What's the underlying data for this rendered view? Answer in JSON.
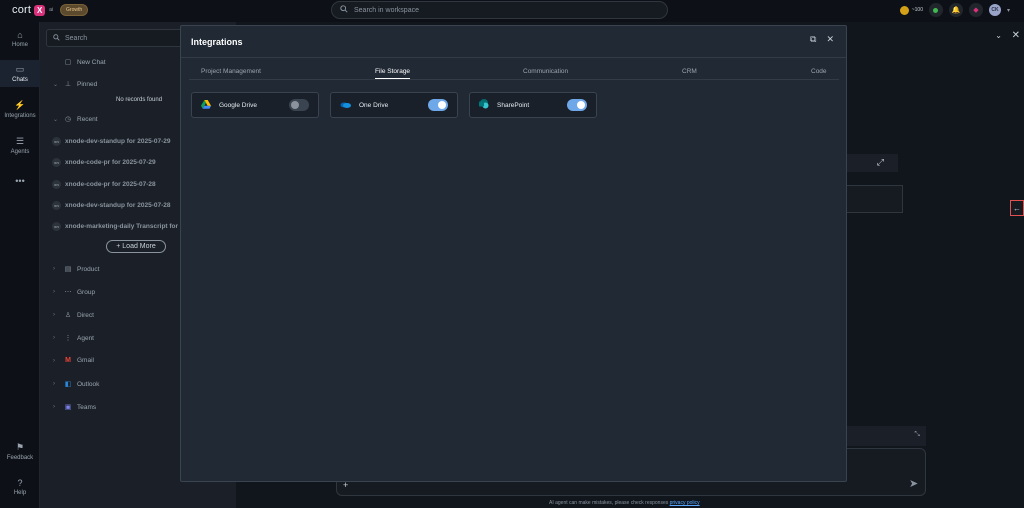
{
  "topbar": {
    "logo_text": "cort",
    "logo_mark": "X",
    "logo_suffix": "ai",
    "badge": "Growth",
    "search_placeholder": "Search in workspace",
    "credits": "~100",
    "avatar_initials": "CK"
  },
  "nav": {
    "items": [
      {
        "label": "Home",
        "icon": "home-icon"
      },
      {
        "label": "Chats",
        "icon": "chat-icon"
      },
      {
        "label": "Integrations",
        "icon": "plug-icon"
      },
      {
        "label": "Agents",
        "icon": "agents-icon"
      },
      {
        "label": "Feedback",
        "icon": "feedback-icon"
      },
      {
        "label": "Help",
        "icon": "help-icon"
      }
    ]
  },
  "sidebar": {
    "search_placeholder": "Search",
    "new_chat": "New Chat",
    "pinned": "Pinned",
    "no_records": "No records found",
    "recent": "Recent",
    "recent_items": [
      "xnode-dev-standup for 2025-07-29",
      "xnode-code-pr for 2025-07-29",
      "xnode-code-pr for 2025-07-28",
      "xnode-dev-standup for 2025-07-28",
      "xnode-marketing-daily Transcript for ..."
    ],
    "load_more": "+ Load More",
    "groups": [
      "Product",
      "Group",
      "Direct",
      "Agent",
      "Gmail",
      "Outlook",
      "Teams"
    ]
  },
  "composer": {
    "disclaimer": "AI agent can make mistakes, please check responses",
    "disclaimer_link": "privacy policy"
  },
  "modal": {
    "title": "Integrations",
    "tabs": [
      "Project Management",
      "File Storage",
      "Communication",
      "CRM",
      "Code"
    ],
    "active_tab": "File Storage",
    "cards": [
      {
        "name": "Google Drive",
        "enabled": false,
        "icon": "google-drive-icon"
      },
      {
        "name": "One Drive",
        "enabled": true,
        "icon": "onedrive-icon"
      },
      {
        "name": "SharePoint",
        "enabled": true,
        "icon": "sharepoint-icon"
      }
    ]
  },
  "colors": {
    "toggle_on": "#6fa8e8",
    "modal_bg": "#212934",
    "brand_accent": "#d9317a"
  }
}
